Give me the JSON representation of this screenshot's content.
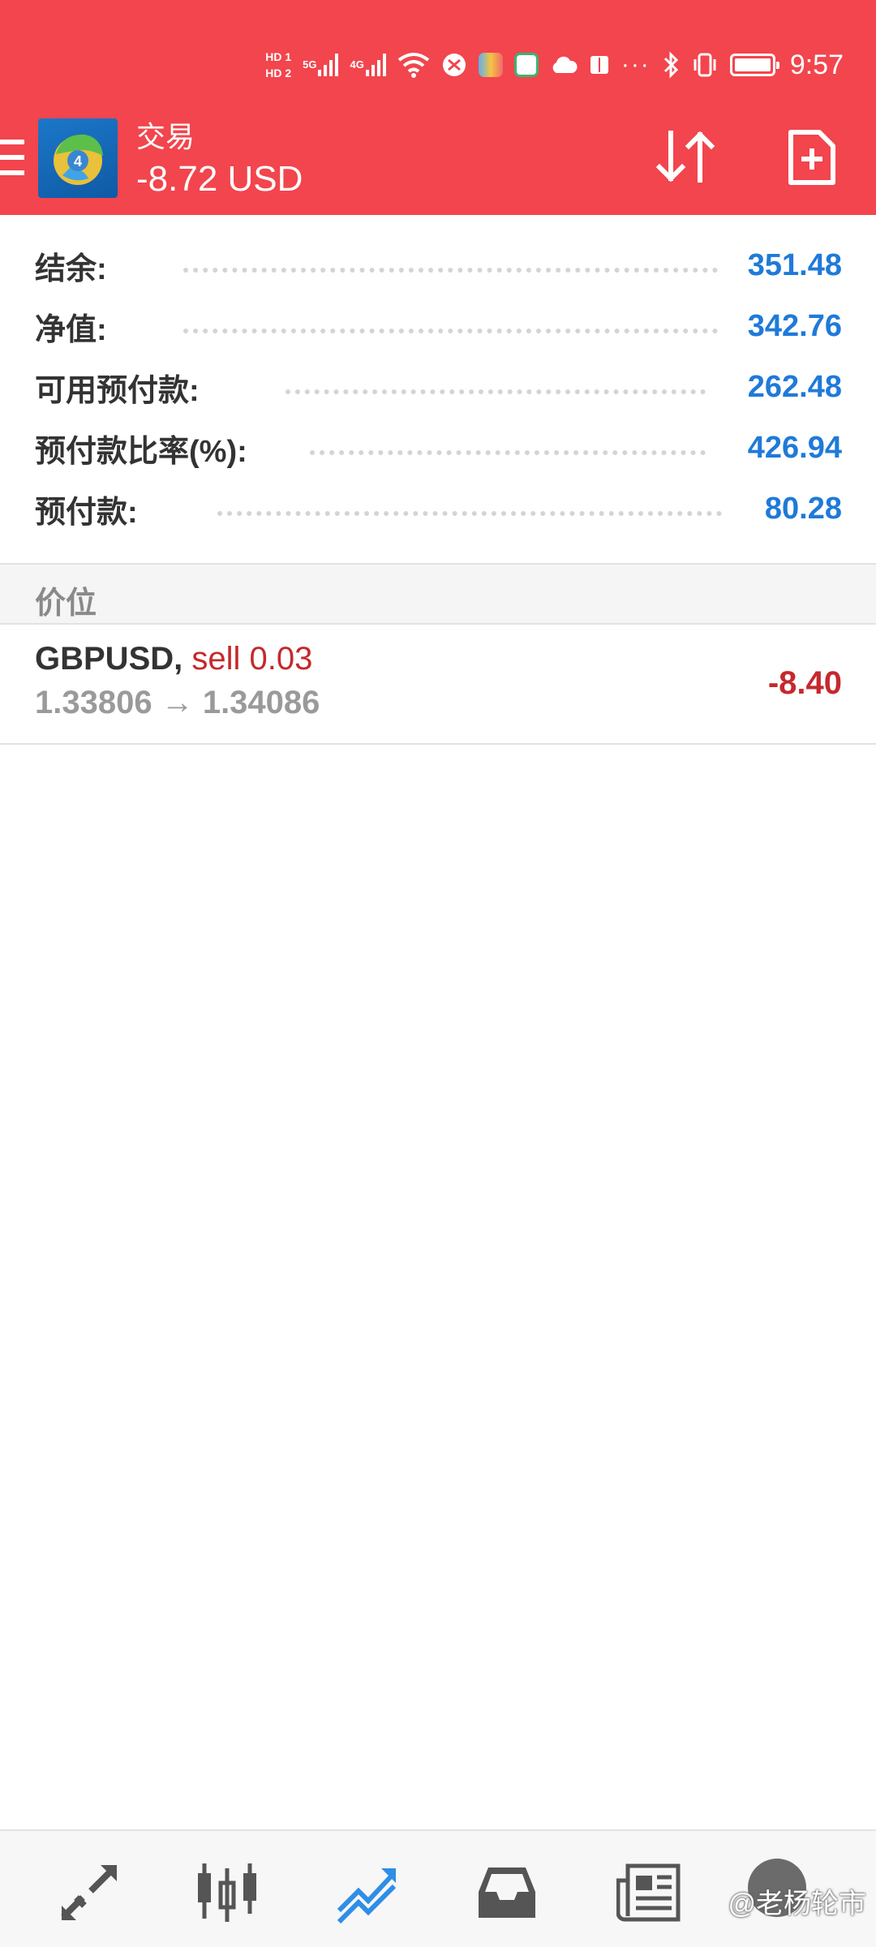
{
  "status_bar": {
    "sim1": "HD 1",
    "sim2": "HD 2",
    "net1": "5G",
    "net2": "4G",
    "dots": "···",
    "time": "9:57"
  },
  "app_bar": {
    "title": "交易",
    "profit": "-8.72 USD",
    "colors": {
      "bar": "#f2454d",
      "text": "#ffffff"
    }
  },
  "summary": [
    {
      "label": "结余:",
      "value": "351.48"
    },
    {
      "label": "净值:",
      "value": "342.76"
    },
    {
      "label": "可用预付款:",
      "value": "262.48"
    },
    {
      "label": "预付款比率(%):",
      "value": "426.94"
    },
    {
      "label": "预付款:",
      "value": "80.28"
    }
  ],
  "positions_section": {
    "header": "价位"
  },
  "positions": [
    {
      "symbol": "GBPUSD,",
      "side": "sell 0.03",
      "prices": "1.33806 → 1.34086",
      "profit": "-8.40"
    }
  ],
  "bottom_nav": {
    "items": [
      "quotes-icon",
      "chart-icon",
      "trade-icon",
      "history-icon",
      "news-icon"
    ],
    "active": "trade-icon",
    "colors": {
      "active": "#2f8ee6",
      "inactive": "#555555"
    }
  },
  "watermark": "@老杨轮市",
  "colors": {
    "value_blue": "#1f7ad8",
    "loss_red": "#c5282d"
  }
}
